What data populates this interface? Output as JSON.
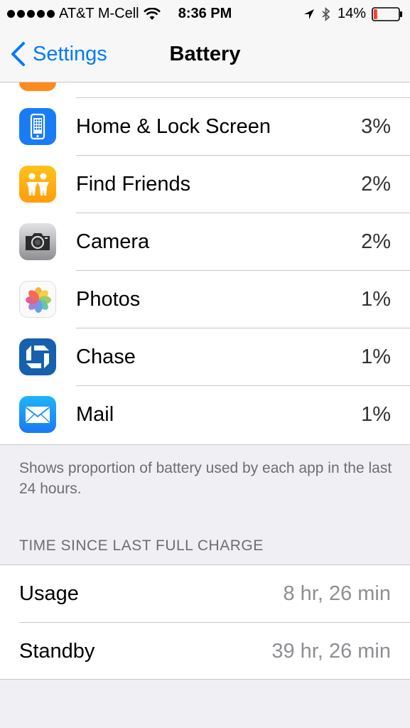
{
  "status_bar": {
    "carrier": "AT&T M-Cell",
    "time": "8:36 PM",
    "battery_percent": "14%",
    "battery_level": 0.14,
    "icons": [
      "signal-dots",
      "wifi-icon",
      "location-arrow-icon",
      "bluetooth-icon",
      "battery-icon"
    ]
  },
  "nav": {
    "back_label": "Settings",
    "title": "Battery"
  },
  "apps": [
    {
      "name": "Home & Lock Screen",
      "percent": "3%",
      "icon": "home-lock-screen-icon"
    },
    {
      "name": "Find Friends",
      "percent": "2%",
      "icon": "find-friends-icon"
    },
    {
      "name": "Camera",
      "percent": "2%",
      "icon": "camera-icon"
    },
    {
      "name": "Photos",
      "percent": "1%",
      "icon": "photos-icon"
    },
    {
      "name": "Chase",
      "percent": "1%",
      "icon": "chase-icon"
    },
    {
      "name": "Mail",
      "percent": "1%",
      "icon": "mail-icon"
    }
  ],
  "footnote": "Shows proportion of battery used by each app in the last 24 hours.",
  "time_section": {
    "header": "TIME SINCE LAST FULL CHARGE",
    "rows": [
      {
        "label": "Usage",
        "value": "8 hr, 26 min"
      },
      {
        "label": "Standby",
        "value": "39 hr, 26 min"
      }
    ]
  },
  "colors": {
    "accent": "#007aff",
    "battery_low": "#ff3b30",
    "background": "#efeff4"
  }
}
